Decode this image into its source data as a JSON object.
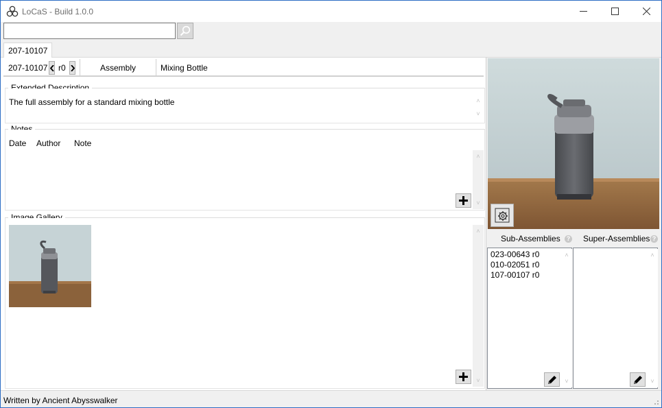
{
  "window": {
    "title": "LoCaS - Build 1.0.0",
    "minimize_icon": "minimize-icon",
    "maximize_icon": "maximize-icon",
    "close_icon": "close-icon"
  },
  "search": {
    "value": "",
    "placeholder": "",
    "button_icon": "search-icon"
  },
  "tabs": [
    {
      "label": "207-10107",
      "active": true
    }
  ],
  "part_header": {
    "part_number": "207-10107",
    "revision": "r0",
    "type": "Assembly",
    "name": "Mixing Bottle"
  },
  "extended_description": {
    "title": "Extended Description",
    "text": "The full assembly for a standard mixing bottle"
  },
  "notes": {
    "title": "Notes",
    "columns": [
      "Date",
      "Author",
      "Note"
    ],
    "rows": [],
    "add_icon": "plus-icon"
  },
  "image_gallery": {
    "title": "Image Gallery",
    "images": [
      "mixing-bottle-thumbnail"
    ],
    "add_icon": "plus-icon"
  },
  "relations": {
    "sub_assemblies": {
      "label": "Sub-Assemblies",
      "items": [
        "023-00643 r0",
        "010-02051 r0",
        "107-00107 r0"
      ]
    },
    "super_assemblies": {
      "label": "Super-Assemblies",
      "items": []
    },
    "help_glyph": "?",
    "edit_icon": "pencil-icon"
  },
  "status": {
    "text": "Written by Ancient Abysswalker"
  },
  "colors": {
    "window_border": "#2b6cc4",
    "chrome": "#f0f0f0",
    "bottle": "#5a5c61",
    "wall": "#c9d6d9",
    "table": "#8a5f39"
  }
}
